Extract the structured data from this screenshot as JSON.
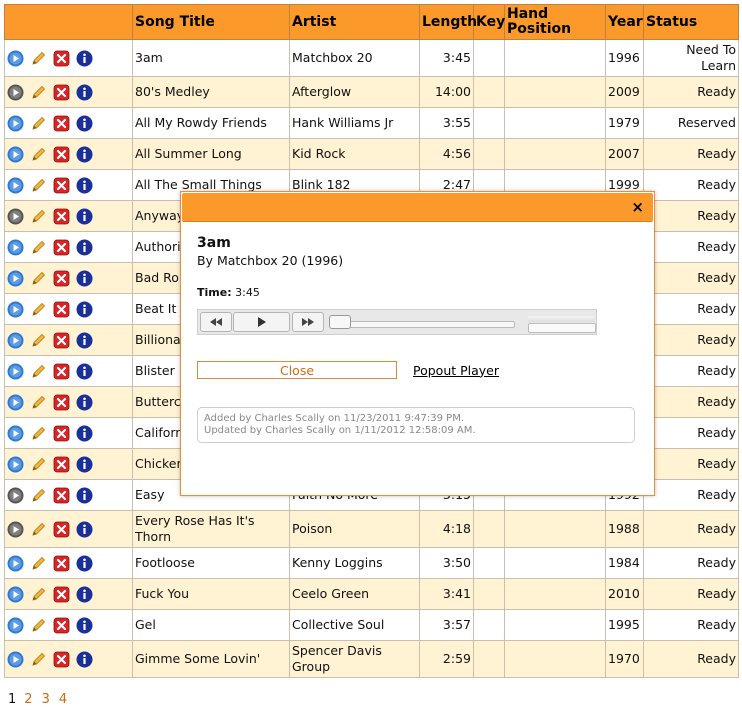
{
  "headers": {
    "song_title": "Song Title",
    "artist": "Artist",
    "length": "Length",
    "key": "Key",
    "hand_position": "Hand Position",
    "year": "Year",
    "status": "Status"
  },
  "icons": {
    "play": "play-icon",
    "edit": "pencil-icon",
    "delete": "delete-icon",
    "info": "info-icon"
  },
  "colors": {
    "header": "#fb9a2a",
    "alt_row": "#fff3d4",
    "link": "#d06a10",
    "play_active": "#2a7ad6",
    "play_inactive": "#555555"
  },
  "rows": [
    {
      "title": "3am",
      "artist": "Matchbox 20",
      "length": "3:45",
      "key": "",
      "hand": "",
      "year": "1996",
      "status": "Need To Learn"
    },
    {
      "title": "80's Medley",
      "artist": "Afterglow",
      "length": "14:00",
      "key": "",
      "hand": "",
      "year": "2009",
      "status": "Ready"
    },
    {
      "title": "All My Rowdy Friends",
      "artist": "Hank Williams Jr",
      "length": "3:55",
      "key": "",
      "hand": "",
      "year": "1979",
      "status": "Reserved"
    },
    {
      "title": "All Summer Long",
      "artist": "Kid Rock",
      "length": "4:56",
      "key": "",
      "hand": "",
      "year": "2007",
      "status": "Ready"
    },
    {
      "title": "All The Small Things",
      "artist": "Blink 182",
      "length": "2:47",
      "key": "",
      "hand": "",
      "year": "1999",
      "status": "Ready"
    },
    {
      "title": "Anyway",
      "artist": "",
      "length": "",
      "key": "",
      "hand": "",
      "year": "",
      "status": "Ready"
    },
    {
      "title": "Authori",
      "artist": "",
      "length": "",
      "key": "",
      "hand": "",
      "year": "",
      "status": "Ready"
    },
    {
      "title": "Bad Ro",
      "artist": "",
      "length": "",
      "key": "",
      "hand": "",
      "year": "",
      "status": "Ready"
    },
    {
      "title": "Beat It",
      "artist": "",
      "length": "",
      "key": "",
      "hand": "",
      "year": "",
      "status": "Ready"
    },
    {
      "title": "Billiona",
      "artist": "",
      "length": "",
      "key": "",
      "hand": "",
      "year": "",
      "status": "Ready"
    },
    {
      "title": "Blister",
      "artist": "",
      "length": "",
      "key": "",
      "hand": "",
      "year": "",
      "status": "Ready"
    },
    {
      "title": "Butterc",
      "artist": "",
      "length": "",
      "key": "",
      "hand": "",
      "year": "",
      "status": "Ready"
    },
    {
      "title": "Californ",
      "artist": "",
      "length": "",
      "key": "",
      "hand": "",
      "year": "",
      "status": "Ready"
    },
    {
      "title": "Chicker",
      "artist": "",
      "length": "",
      "key": "",
      "hand": "",
      "year": "",
      "status": "Ready"
    },
    {
      "title": "Easy",
      "artist": "Faith No More",
      "length": "3:15",
      "key": "",
      "hand": "",
      "year": "1992",
      "status": "Ready"
    },
    {
      "title": "Every Rose Has It's Thorn",
      "artist": "Poison",
      "length": "4:18",
      "key": "",
      "hand": "",
      "year": "1988",
      "status": "Ready"
    },
    {
      "title": "Footloose",
      "artist": "Kenny Loggins",
      "length": "3:50",
      "key": "",
      "hand": "",
      "year": "1984",
      "status": "Ready"
    },
    {
      "title": "Fuck You",
      "artist": "Ceelo Green",
      "length": "3:41",
      "key": "",
      "hand": "",
      "year": "2010",
      "status": "Ready"
    },
    {
      "title": "Gel",
      "artist": "Collective Soul",
      "length": "3:57",
      "key": "",
      "hand": "",
      "year": "1995",
      "status": "Ready"
    },
    {
      "title": "Gimme Some Lovin'",
      "artist": "Spencer Davis Group",
      "length": "2:59",
      "key": "",
      "hand": "",
      "year": "1970",
      "status": "Ready"
    }
  ],
  "row_play_active": [
    true,
    false,
    true,
    true,
    true,
    false,
    true,
    true,
    true,
    true,
    true,
    true,
    true,
    true,
    false,
    false,
    true,
    true,
    true,
    true
  ],
  "pagination": {
    "current": "1",
    "pages": [
      "2",
      "3",
      "4"
    ]
  },
  "modal": {
    "title": "3am",
    "by_line": "By Matchbox 20 (1996)",
    "time_label": "Time:",
    "time_value": "3:45",
    "close_label": "Close",
    "popout_label": "Popout Player",
    "added_line": "Added by Charles Scally on 11/23/2011 9:47:39 PM.",
    "updated_line": "Updated by Charles Scally on 1/11/2012 12:58:09 AM.",
    "close_x": "×"
  }
}
